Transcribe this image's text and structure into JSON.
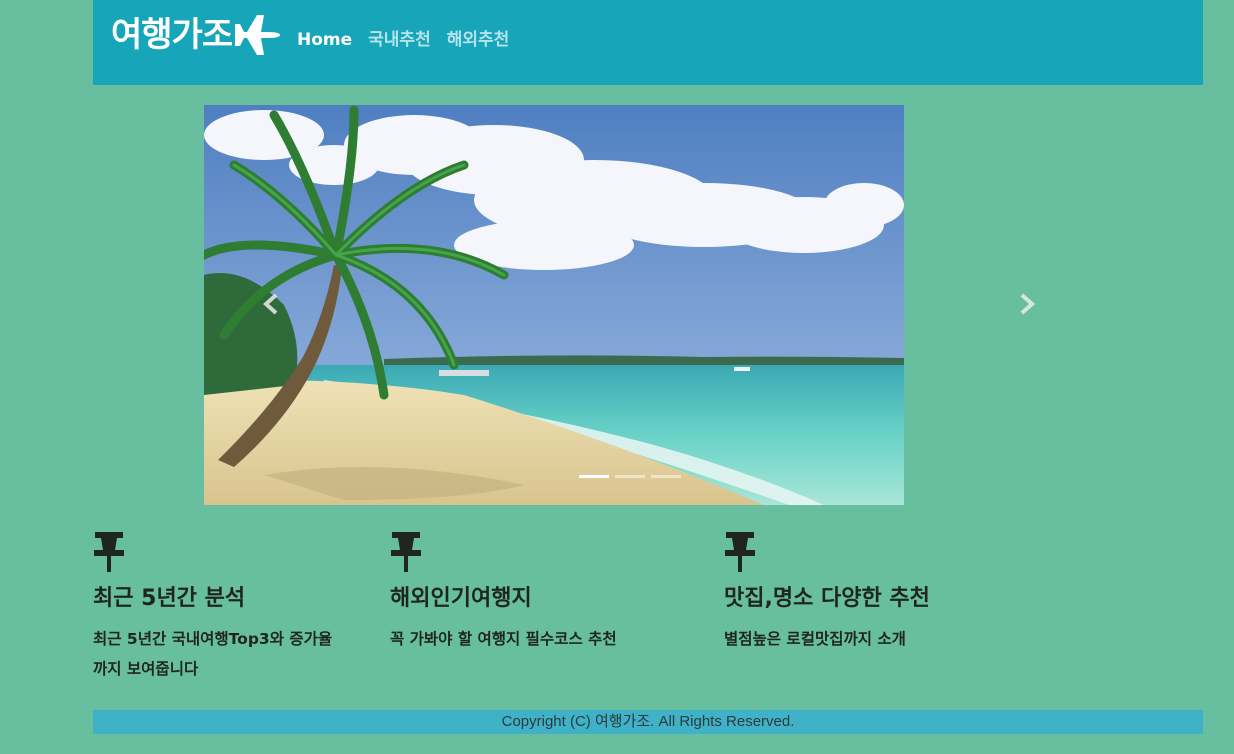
{
  "header": {
    "brand": "여행가조",
    "brand_icon": "airplane-icon",
    "nav": [
      {
        "label": "Home",
        "active": true
      },
      {
        "label": "국내추천",
        "active": false
      },
      {
        "label": "해외추천",
        "active": false
      }
    ],
    "colors": {
      "bar": "#17a5ba",
      "active": "#ffffff",
      "inactive": "#b6e3ea"
    }
  },
  "carousel": {
    "slide": "tropical-beach-with-palm-tree",
    "prev_icon": "chevron-left-icon",
    "next_icon": "chevron-right-icon",
    "slide_count": 3,
    "active_index": 0
  },
  "features": [
    {
      "icon": "pushpin-icon",
      "title": "최근 5년간 분석",
      "description": "최근 5년간 국내여행Top3와 증가율까지 보여줍니다"
    },
    {
      "icon": "pushpin-icon",
      "title": "해외인기여행지",
      "description": "꼭 가봐야 할 여행지 필수코스 추천"
    },
    {
      "icon": "pushpin-icon",
      "title": "맛집,명소 다양한 추천",
      "description": "별점높은 로컬맛집까지 소개"
    }
  ],
  "footer": {
    "text": "Copyright (C) 여행가조. All Rights Reserved."
  },
  "colors": {
    "page_background": "#68bf9f",
    "footer_background": "#3fb2c8"
  }
}
